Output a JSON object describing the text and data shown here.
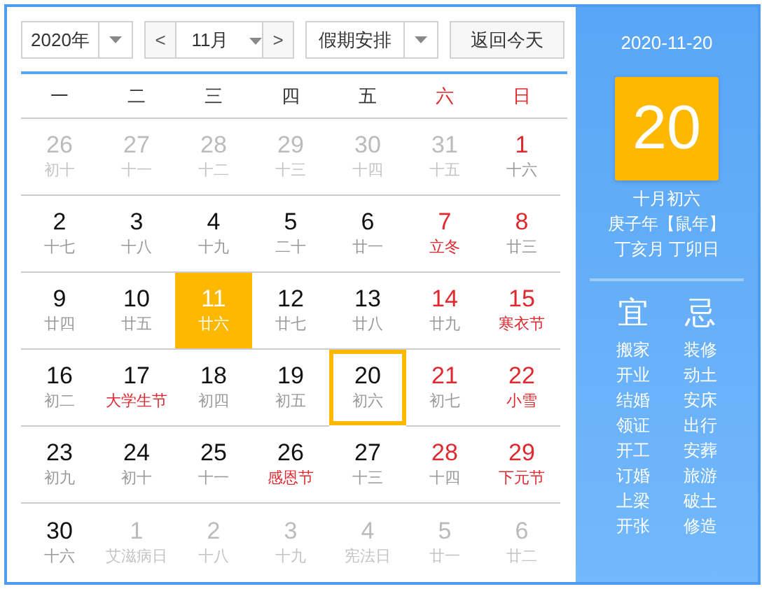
{
  "toolbar": {
    "year": "2020年",
    "prev": "<",
    "month": "11月",
    "next": ">",
    "holiday_select": "假期安排",
    "today_button": "返回今天"
  },
  "weekdays": [
    {
      "label": "一",
      "weekend": false
    },
    {
      "label": "二",
      "weekend": false
    },
    {
      "label": "三",
      "weekend": false
    },
    {
      "label": "四",
      "weekend": false
    },
    {
      "label": "五",
      "weekend": false
    },
    {
      "label": "六",
      "weekend": true
    },
    {
      "label": "日",
      "weekend": true
    }
  ],
  "weeks": [
    [
      {
        "day": "26",
        "lunar": "初十",
        "other_month": true,
        "festival": false,
        "today": false,
        "selected": false
      },
      {
        "day": "27",
        "lunar": "十一",
        "other_month": true,
        "festival": false,
        "today": false,
        "selected": false
      },
      {
        "day": "28",
        "lunar": "十二",
        "other_month": true,
        "festival": false,
        "today": false,
        "selected": false
      },
      {
        "day": "29",
        "lunar": "十三",
        "other_month": true,
        "festival": false,
        "today": false,
        "selected": false
      },
      {
        "day": "30",
        "lunar": "十四",
        "other_month": true,
        "festival": false,
        "today": false,
        "selected": false
      },
      {
        "day": "31",
        "lunar": "十五",
        "other_month": true,
        "festival": false,
        "today": false,
        "selected": false
      },
      {
        "day": "1",
        "lunar": "十六",
        "other_month": false,
        "festival": false,
        "today": false,
        "selected": false
      }
    ],
    [
      {
        "day": "2",
        "lunar": "十七",
        "other_month": false,
        "festival": false,
        "today": false,
        "selected": false
      },
      {
        "day": "3",
        "lunar": "十八",
        "other_month": false,
        "festival": false,
        "today": false,
        "selected": false
      },
      {
        "day": "4",
        "lunar": "十九",
        "other_month": false,
        "festival": false,
        "today": false,
        "selected": false
      },
      {
        "day": "5",
        "lunar": "二十",
        "other_month": false,
        "festival": false,
        "today": false,
        "selected": false
      },
      {
        "day": "6",
        "lunar": "廿一",
        "other_month": false,
        "festival": false,
        "today": false,
        "selected": false
      },
      {
        "day": "7",
        "lunar": "立冬",
        "other_month": false,
        "festival": true,
        "today": false,
        "selected": false
      },
      {
        "day": "8",
        "lunar": "廿三",
        "other_month": false,
        "festival": false,
        "today": false,
        "selected": false
      }
    ],
    [
      {
        "day": "9",
        "lunar": "廿四",
        "other_month": false,
        "festival": false,
        "today": false,
        "selected": false
      },
      {
        "day": "10",
        "lunar": "廿五",
        "other_month": false,
        "festival": false,
        "today": false,
        "selected": false
      },
      {
        "day": "11",
        "lunar": "廿六",
        "other_month": false,
        "festival": false,
        "today": true,
        "selected": false
      },
      {
        "day": "12",
        "lunar": "廿七",
        "other_month": false,
        "festival": false,
        "today": false,
        "selected": false
      },
      {
        "day": "13",
        "lunar": "廿八",
        "other_month": false,
        "festival": false,
        "today": false,
        "selected": false
      },
      {
        "day": "14",
        "lunar": "廿九",
        "other_month": false,
        "festival": false,
        "today": false,
        "selected": false
      },
      {
        "day": "15",
        "lunar": "寒衣节",
        "other_month": false,
        "festival": true,
        "today": false,
        "selected": false
      }
    ],
    [
      {
        "day": "16",
        "lunar": "初二",
        "other_month": false,
        "festival": false,
        "today": false,
        "selected": false
      },
      {
        "day": "17",
        "lunar": "大学生节",
        "other_month": false,
        "festival": true,
        "today": false,
        "selected": false
      },
      {
        "day": "18",
        "lunar": "初四",
        "other_month": false,
        "festival": false,
        "today": false,
        "selected": false
      },
      {
        "day": "19",
        "lunar": "初五",
        "other_month": false,
        "festival": false,
        "today": false,
        "selected": false
      },
      {
        "day": "20",
        "lunar": "初六",
        "other_month": false,
        "festival": false,
        "today": false,
        "selected": true
      },
      {
        "day": "21",
        "lunar": "初七",
        "other_month": false,
        "festival": false,
        "today": false,
        "selected": false
      },
      {
        "day": "22",
        "lunar": "小雪",
        "other_month": false,
        "festival": true,
        "today": false,
        "selected": false
      }
    ],
    [
      {
        "day": "23",
        "lunar": "初九",
        "other_month": false,
        "festival": false,
        "today": false,
        "selected": false
      },
      {
        "day": "24",
        "lunar": "初十",
        "other_month": false,
        "festival": false,
        "today": false,
        "selected": false
      },
      {
        "day": "25",
        "lunar": "十一",
        "other_month": false,
        "festival": false,
        "today": false,
        "selected": false
      },
      {
        "day": "26",
        "lunar": "感恩节",
        "other_month": false,
        "festival": true,
        "today": false,
        "selected": false
      },
      {
        "day": "27",
        "lunar": "十三",
        "other_month": false,
        "festival": false,
        "today": false,
        "selected": false
      },
      {
        "day": "28",
        "lunar": "十四",
        "other_month": false,
        "festival": false,
        "today": false,
        "selected": false
      },
      {
        "day": "29",
        "lunar": "下元节",
        "other_month": false,
        "festival": true,
        "today": false,
        "selected": false
      }
    ],
    [
      {
        "day": "30",
        "lunar": "十六",
        "other_month": false,
        "festival": false,
        "today": false,
        "selected": false
      },
      {
        "day": "1",
        "lunar": "艾滋病日",
        "other_month": true,
        "festival": false,
        "today": false,
        "selected": false
      },
      {
        "day": "2",
        "lunar": "十八",
        "other_month": true,
        "festival": false,
        "today": false,
        "selected": false
      },
      {
        "day": "3",
        "lunar": "十九",
        "other_month": true,
        "festival": false,
        "today": false,
        "selected": false
      },
      {
        "day": "4",
        "lunar": "宪法日",
        "other_month": true,
        "festival": false,
        "today": false,
        "selected": false
      },
      {
        "day": "5",
        "lunar": "廿一",
        "other_month": true,
        "festival": false,
        "today": false,
        "selected": false
      },
      {
        "day": "6",
        "lunar": "廿二",
        "other_month": true,
        "festival": false,
        "today": false,
        "selected": false
      }
    ]
  ],
  "detail": {
    "date": "2020-11-20",
    "day": "20",
    "lunar_date": "十月初六",
    "year_line": "庚子年【鼠年】",
    "month_day_line": "丁亥月 丁卯日",
    "good": {
      "heading": "宜",
      "items": [
        "搬家",
        "开业",
        "结婚",
        "领证",
        "开工",
        "订婚",
        "上梁",
        "开张"
      ]
    },
    "bad": {
      "heading": "忌",
      "items": [
        "装修",
        "动土",
        "安床",
        "出行",
        "安葬",
        "旅游",
        "破土",
        "修造"
      ]
    }
  }
}
